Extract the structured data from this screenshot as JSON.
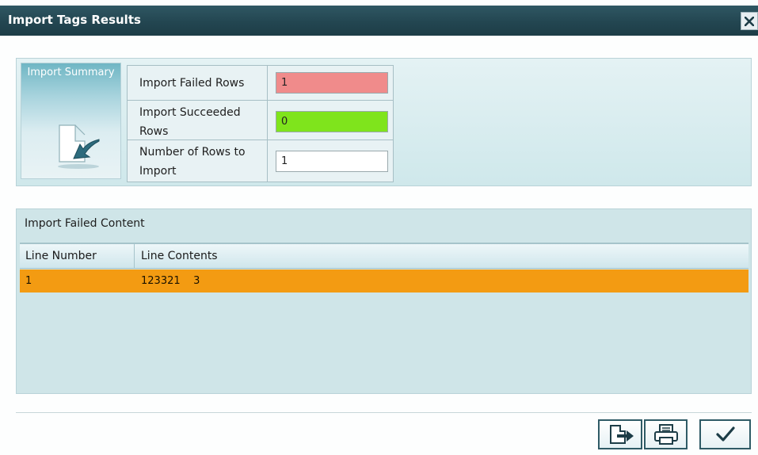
{
  "window": {
    "title": "Import Tags Results",
    "close_label": "X"
  },
  "summary": {
    "card_label": "Import Summary",
    "fields": [
      {
        "label": "Import Failed Rows",
        "value": "1"
      },
      {
        "label": "Import Succeeded Rows",
        "value": "0"
      },
      {
        "label": "Number of Rows to Import",
        "value": "1"
      }
    ]
  },
  "failed_content": {
    "title": "Import Failed Content",
    "columns": [
      "Line Number",
      "Line Contents"
    ],
    "rows": [
      {
        "line_number": "1",
        "line_contents": "123321    3"
      }
    ]
  },
  "colors": {
    "titlebar": "#234651",
    "failed_value": "#f08b8b",
    "succeeded_value": "#7fe41c",
    "selected_row": "#f39b12"
  },
  "icons": {
    "card": "import-document-arrow-icon",
    "export": "export-icon",
    "print": "print-icon",
    "ok": "checkmark-icon",
    "close": "close-icon"
  }
}
